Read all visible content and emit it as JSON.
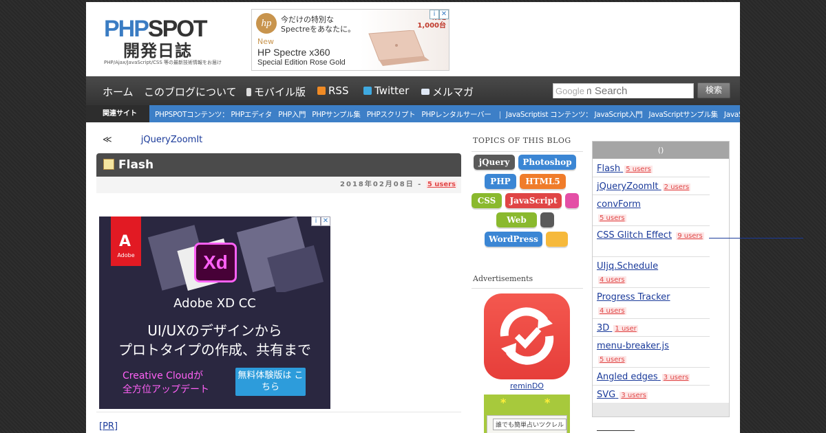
{
  "header": {
    "logo_main": "PHP",
    "logo_spot": "SPOT",
    "logo_sub": "開発日誌",
    "logo_tagline": "PHP/Ajax/JavaScript/CSS 等の最新技術情報をお届け"
  },
  "hp_ad": {
    "brand": "hp",
    "line1": "今だけの特別な Spectreをあなたに。",
    "badge": "限定 1,000台",
    "new": "New",
    "product": "HP Spectre x360",
    "edition": "Special Edition Rose Gold"
  },
  "nav": {
    "items": [
      "ホーム",
      "このブログについて",
      "モバイル版",
      "RSS",
      "Twitter",
      "メルマガ"
    ],
    "search_placeholder": "Custom Search",
    "search_brand": "Google",
    "search_button": "検索"
  },
  "related": {
    "label": "関連サイト",
    "php_group": "PHPSPOTコンテンツ：",
    "php_links": [
      "PHPエディタ",
      "PHP入門",
      "PHPサンプル集",
      "PHPスクリプト",
      "PHPレンタルサーバー"
    ],
    "js_group": "JavaScriptist コンテンツ：",
    "js_links": [
      "JavaScript入門",
      "JavaScriptサンプル集",
      "JavaScriptリファレンス"
    ]
  },
  "post": {
    "prev": "≪",
    "next_link": "jQueryZoomIt",
    "title": "Flash",
    "date": "2018年02月08日 -",
    "users": "5 users",
    "pr": "[PR]"
  },
  "adobe_ad": {
    "brand": "Adobe",
    "product_icon": "Xd",
    "title": "Adobe XD CC",
    "line1": "UI/UXのデザインから",
    "line2": "プロトタイプの作成、共有まで",
    "cc_line1": "Creative Cloudが",
    "cc_line2": "全方位アップデート",
    "button": "無料体験版は こちら"
  },
  "topics": {
    "title": "TOPICS OF THIS BLOG",
    "tags": [
      {
        "label": "jQuery",
        "color": "#5a5a5a"
      },
      {
        "label": "Photoshop",
        "color": "#3b86d4"
      },
      {
        "label": "PHP",
        "color": "#3b86d4"
      },
      {
        "label": "HTML5",
        "color": "#f07c2a"
      },
      {
        "label": "CSS",
        "color": "#8ab92e"
      },
      {
        "label": "JavaScript",
        "color": "#e04545"
      },
      {
        "label": "",
        "color": "#e44fa6"
      },
      {
        "label": "Web",
        "color": "#8ab92e"
      },
      {
        "label": "",
        "color": "#5a5a5a"
      },
      {
        "label": "WordPress",
        "color": "#3b86d4"
      },
      {
        "label": "",
        "color": "#f6b93b"
      }
    ]
  },
  "ads": {
    "title": "Advertisements",
    "remindo_label": "reminDO",
    "green_text": "誰でも簡単占いツクレル"
  },
  "ranking": {
    "header": "()",
    "items": [
      {
        "title": "Flash",
        "users": "5 users"
      },
      {
        "title": "jQueryZoomIt",
        "users": "2 users"
      },
      {
        "title": "convForm",
        "users": "5 users"
      },
      {
        "title": "CSS Glitch Effect",
        "users": "9 users"
      },
      {
        "title": "UIjq.Schedule",
        "users": "4 users"
      },
      {
        "title": "Progress Tracker",
        "users": "4 users"
      },
      {
        "title": "3D",
        "users": "1 user"
      },
      {
        "title": "menu-breaker.js",
        "users": "5 users"
      },
      {
        "title": "Angled edges",
        "users": "3 users"
      },
      {
        "title": "SVG",
        "users": "3 users"
      }
    ]
  }
}
